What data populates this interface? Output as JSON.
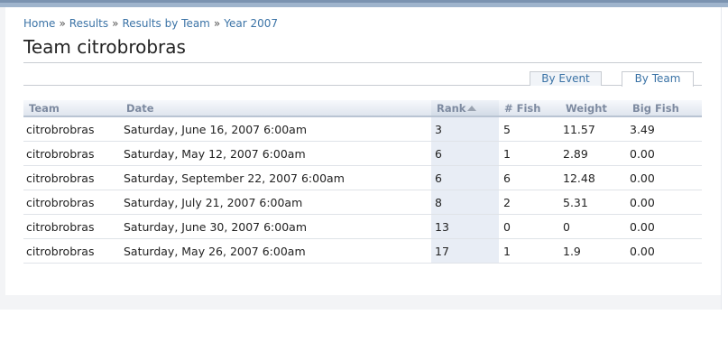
{
  "breadcrumb": {
    "items": [
      "Home",
      "Results",
      "Results by Team",
      "Year 2007"
    ],
    "separator": "»"
  },
  "page_title": "Team citrobrobras",
  "tabs": [
    {
      "label": "By Event",
      "active": false
    },
    {
      "label": "By Team",
      "active": true
    }
  ],
  "table": {
    "columns": [
      "Team",
      "Date",
      "Rank",
      "# Fish",
      "Weight",
      "Big Fish"
    ],
    "sorted_by": "Rank",
    "rows": [
      {
        "team": "citrobrobras",
        "date": "Saturday, June 16, 2007 6:00am",
        "rank": "3",
        "fish": "5",
        "weight": "11.57",
        "big_fish": "3.49"
      },
      {
        "team": "citrobrobras",
        "date": "Saturday, May 12, 2007 6:00am",
        "rank": "6",
        "fish": "1",
        "weight": "2.89",
        "big_fish": "0.00"
      },
      {
        "team": "citrobrobras",
        "date": "Saturday, September 22, 2007 6:00am",
        "rank": "6",
        "fish": "6",
        "weight": "12.48",
        "big_fish": "0.00"
      },
      {
        "team": "citrobrobras",
        "date": "Saturday, July 21, 2007 6:00am",
        "rank": "8",
        "fish": "2",
        "weight": "5.31",
        "big_fish": "0.00"
      },
      {
        "team": "citrobrobras",
        "date": "Saturday, June 30, 2007 6:00am",
        "rank": "13",
        "fish": "0",
        "weight": "0",
        "big_fish": "0.00"
      },
      {
        "team": "citrobrobras",
        "date": "Saturday, May 26, 2007 6:00am",
        "rank": "17",
        "fish": "1",
        "weight": "1.9",
        "big_fish": "0.00"
      }
    ]
  },
  "colors": {
    "link": "#3b73a6",
    "header_text": "#7d8aa0",
    "rank_column_bg": "#e8edf5"
  }
}
